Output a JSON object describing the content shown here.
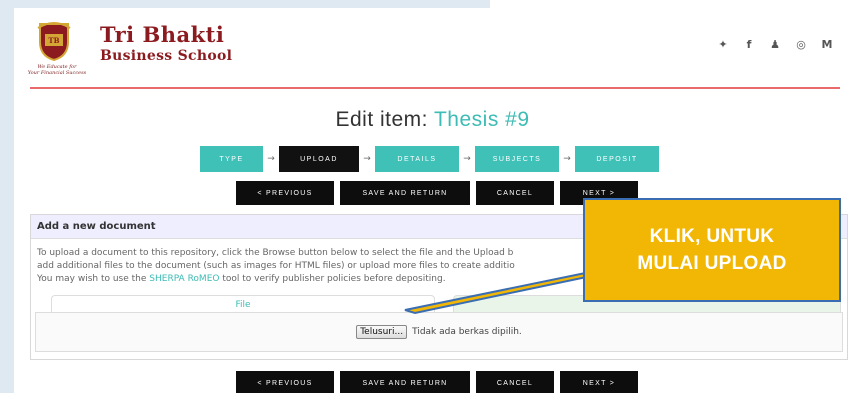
{
  "brand": {
    "title": "Tri Bhakti",
    "subtitle": "Business School",
    "tagline_line1": "We Educate for",
    "tagline_line2": "Your Financial Success",
    "crest_text": "TB"
  },
  "social_icons": [
    {
      "name": "twitter-icon",
      "glyph": "✦"
    },
    {
      "name": "facebook-icon",
      "glyph": "f"
    },
    {
      "name": "snapchat-icon",
      "glyph": "♟"
    },
    {
      "name": "instagram-icon",
      "glyph": "◎"
    },
    {
      "name": "medium-icon",
      "glyph": "M"
    }
  ],
  "heading": {
    "prefix": "Edit item: ",
    "accent": "Thesis #9"
  },
  "steps": [
    {
      "label": "TYPE",
      "active": false
    },
    {
      "label": "UPLOAD",
      "active": true
    },
    {
      "label": "DETAILS",
      "active": false
    },
    {
      "label": "SUBJECTS",
      "active": false
    },
    {
      "label": "DEPOSIT",
      "active": false
    }
  ],
  "nav_buttons": {
    "previous": "< PREVIOUS",
    "save": "SAVE AND RETURN",
    "cancel": "CANCEL",
    "next": "NEXT >"
  },
  "doc_panel": {
    "header": "Add a new document",
    "line1": "To upload a document to this repository, click the Browse button below to select the file and the Upload b",
    "line2": "add additional files to the document (such as images for HTML files) or upload more files to create additio",
    "line3_prefix": "You may wish to use the ",
    "line3_link": "SHERPA RoMEO",
    "line3_suffix": " tool to verify publisher policies before depositing.",
    "tab_file": "File",
    "browse_button": "Telusuri...",
    "no_file_text": "Tidak ada berkas dipilih."
  },
  "callout": {
    "line1": "KLIK, UNTUK",
    "line2": "MULAI UPLOAD"
  },
  "colors": {
    "accent": "#3dbcb5",
    "brand": "#8b1b1f",
    "callout_bg": "#f2b705",
    "callout_border": "#3b6db2"
  }
}
